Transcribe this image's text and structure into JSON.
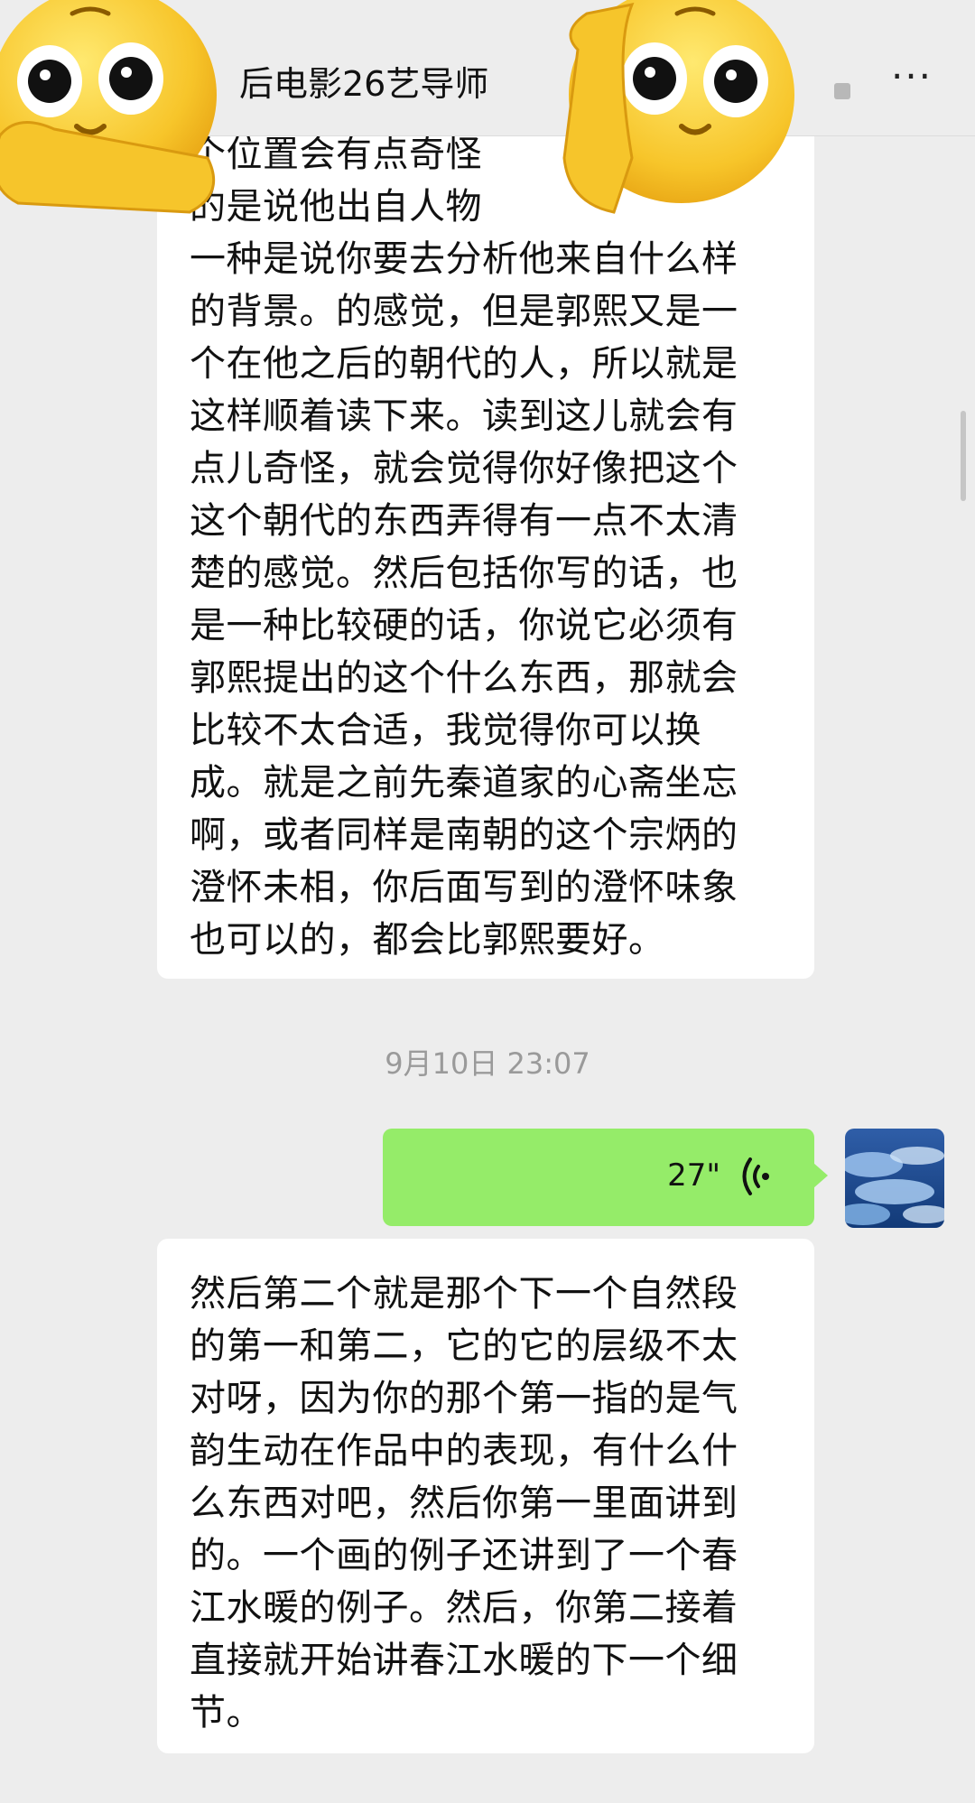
{
  "header": {
    "title": "后电影26艺导师",
    "more_label": "···"
  },
  "messages": [
    {
      "type": "text",
      "sender": "other",
      "lines": [
        "个位置会有点奇怪",
        "的是说他出自人物",
        "一种是说你要去分析他来自什么样",
        "的背景。的感觉，但是郭熙又是一",
        "个在他之后的朝代的人，所以就是",
        "这样顺着读下来。读到这儿就会有",
        "点儿奇怪，就会觉得你好像把这个",
        "这个朝代的东西弄得有一点不太清",
        "楚的感觉。然后包括你写的话，也",
        "是一种比较硬的话，你说它必须有",
        "郭熙提出的这个什么东西，那就会",
        "比较不太合适，我觉得你可以换",
        "成。就是之前先秦道家的心斋坐忘",
        "啊，或者同样是南朝的这个宗炳的",
        "澄怀未相，你后面写到的澄怀味象",
        "也可以的，都会比郭熙要好。"
      ]
    },
    {
      "type": "timestamp",
      "text": "9月10日 23:07"
    },
    {
      "type": "voice",
      "sender": "self",
      "duration": "27\""
    },
    {
      "type": "text",
      "sender": "other",
      "lines": [
        "然后第二个就是那个下一个自然段",
        "的第一和第二，它的它的层级不太",
        "对呀，因为你的那个第一指的是气",
        "韵生动在作品中的表现，有什么什",
        "么东西对吧，然后你第一里面讲到",
        "的。一个画的例子还讲到了一个春",
        "江水暖的例子。然后，你第二接着",
        "直接就开始讲春江水暖的下一个细",
        "节。"
      ]
    }
  ],
  "colors": {
    "background": "#ededed",
    "bubble_other": "#ffffff",
    "bubble_self": "#95ec69",
    "timestamp": "#9a9a9a"
  },
  "icons": [
    "emoji-sticker-icon",
    "voice-wave-icon",
    "avatar-image",
    "more-icon"
  ]
}
